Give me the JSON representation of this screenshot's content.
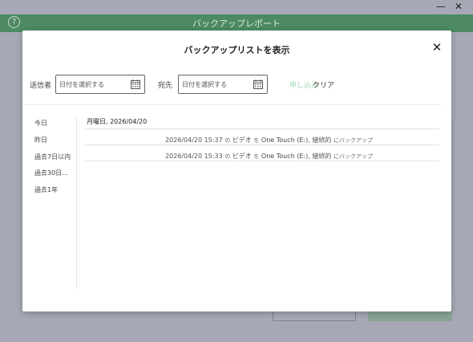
{
  "app": {
    "title": "バックアップレポート",
    "help_glyph": "?",
    "minimize_glyph": "—",
    "close_glyph": "✕"
  },
  "modal": {
    "title": "バックアップリストを表示",
    "close_glyph": "✕",
    "sender_label": "送信者",
    "recipient_label": "宛先",
    "sender_placeholder": "日付を選択する",
    "recipient_placeholder": "日付を選択する",
    "apply_label": "申し込み",
    "clear_label": "クリア"
  },
  "sidebar": {
    "items": [
      {
        "label": "今日"
      },
      {
        "label": "昨日"
      },
      {
        "label": "過去7日以内"
      },
      {
        "label": "過去30日…"
      },
      {
        "label": "過去1年"
      }
    ]
  },
  "list": {
    "date_header": "月曜日, 2026/04/20",
    "entries": [
      {
        "time": "2026/04/20 15:37",
        "p1": "の",
        "type": "ビデオ",
        "p2": "を",
        "device": "One Touch (E:)",
        "sep": ",",
        "mode": "継続的",
        "suffix": "にバックアップ"
      },
      {
        "time": "2026/04/20 15:33",
        "p1": "の",
        "type": "ビデオ",
        "p2": "を",
        "device": "One Touch (E:)",
        "sep": ",",
        "mode": "継続的",
        "suffix": "にバックアップ"
      }
    ]
  },
  "colors": {
    "accent_green": "#4d8a62",
    "apply_disabled": "#9ed8b0",
    "overlay": "#a6a8b6"
  }
}
